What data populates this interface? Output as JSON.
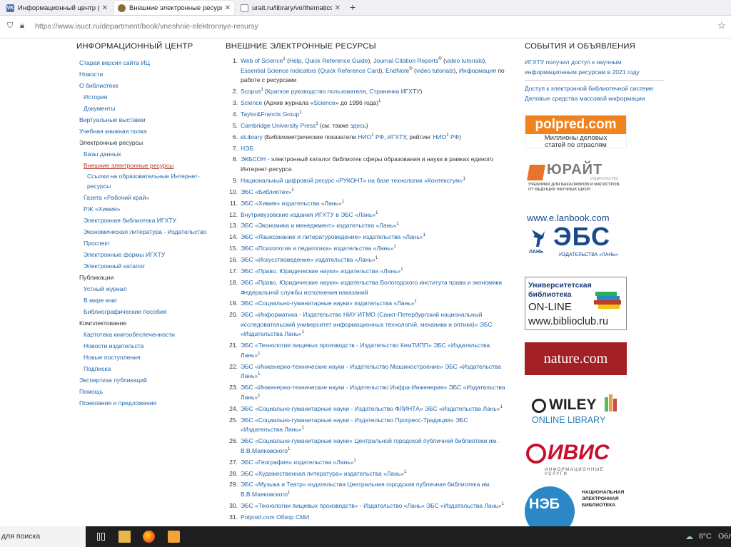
{
  "tabs": [
    {
      "title": "Информационный центр (биб",
      "icon": "vk-icon",
      "color": "#4a76a8"
    },
    {
      "title": "Внешние электронные ресурсы",
      "icon": "site-icon",
      "color": "#8a6a3a"
    },
    {
      "title": "urait.ru/library/vo/thematics/yu",
      "icon": "page-icon",
      "color": "#777"
    }
  ],
  "url": "https://www.isuct.ru/department/book/vneshnie-elektronnye-resursy",
  "headings": {
    "left": "ИНФОРМАЦИОННЫЙ ЦЕНТР",
    "mid": "ВНЕШНИЕ ЭЛЕКТРОННЫЕ РЕСУРСЫ",
    "right": "СОБЫТИЯ И ОБЪЯВЛЕНИЯ"
  },
  "left_nav": [
    {
      "label": "Старая версия сайта ИЦ",
      "level": 0
    },
    {
      "label": "Новости",
      "level": 0
    },
    {
      "label": "О библиотеке",
      "level": 0
    },
    {
      "label": "История",
      "level": 1
    },
    {
      "label": "Документы",
      "level": 1
    },
    {
      "label": "Виртуальные выставки",
      "level": 0
    },
    {
      "label": "Учебная книжная полка",
      "level": 0
    },
    {
      "label": "Электронные ресурсы",
      "level": 0,
      "group": true
    },
    {
      "label": "Базы данных",
      "level": 1
    },
    {
      "label": "Внешние электронные ресурсы",
      "level": 1,
      "current": true
    },
    {
      "label": "Ссылки на образовательные Интернет-ресурсы",
      "level": 2
    },
    {
      "label": "Газета «Рабочий край»",
      "level": 1
    },
    {
      "label": "РЖ «Химия»",
      "level": 1
    },
    {
      "label": "Электронная библиотека ИГХТУ",
      "level": 1
    },
    {
      "label": "Экономическая литература - Издательство Проспект",
      "level": 1,
      "wrap": true
    },
    {
      "label": "Электронные формы ИГХТУ",
      "level": 1
    },
    {
      "label": "Электронный каталог",
      "level": 1
    },
    {
      "label": "Публикации",
      "level": 0,
      "group": true
    },
    {
      "label": "Устный журнал",
      "level": 1
    },
    {
      "label": "В мире книг",
      "level": 1
    },
    {
      "label": "Библиографические пособия",
      "level": 1
    },
    {
      "label": "Комплектование",
      "level": 0,
      "group": true
    },
    {
      "label": "Картотека книгообеспеченности",
      "level": 1
    },
    {
      "label": "Новости издательств",
      "level": 1
    },
    {
      "label": "Новые поступления",
      "level": 1
    },
    {
      "label": "Подписка",
      "level": 1
    },
    {
      "label": "Экспертиза публикаций",
      "level": 0
    },
    {
      "label": "Помощь",
      "level": 0
    },
    {
      "label": "Пожелания и предложения",
      "level": 0
    }
  ],
  "resources": [
    {
      "n": "1.",
      "parts": [
        {
          "t": "Web of Science",
          "l": 1,
          "s": "1"
        },
        {
          "t": " ("
        },
        {
          "t": "Help",
          "l": 1
        },
        {
          "t": ", "
        },
        {
          "t": "Quick Reference Guide",
          "l": 1
        },
        {
          "t": "), "
        },
        {
          "t": "Journal Citation Reports",
          "l": 1,
          "s": "®"
        },
        {
          "t": " ("
        },
        {
          "t": "video tutorials",
          "l": 1
        },
        {
          "t": "), "
        },
        {
          "t": "Essential Science Indicators",
          "l": 1
        },
        {
          "t": " ("
        },
        {
          "t": "Quick Reference Card",
          "l": 1
        },
        {
          "t": "), "
        },
        {
          "t": "EndNote",
          "l": 1,
          "s": "®"
        },
        {
          "t": " ("
        },
        {
          "t": "video tutorials",
          "l": 1
        },
        {
          "t": "), "
        },
        {
          "t": "Информация",
          "l": 1
        },
        {
          "t": " по работе с ресурсами"
        }
      ]
    },
    {
      "n": "2.",
      "parts": [
        {
          "t": "Scopus",
          "l": 1,
          "s": "1"
        },
        {
          "t": " ("
        },
        {
          "t": "Краткое руководство пользователя",
          "l": 1
        },
        {
          "t": ", "
        },
        {
          "t": "Страничка ИГХТУ",
          "l": 1
        },
        {
          "t": ")"
        }
      ]
    },
    {
      "n": "3.",
      "parts": [
        {
          "t": "Science",
          "l": 1
        },
        {
          "t": " (Архив журнала «"
        },
        {
          "t": "Science",
          "l": 1
        },
        {
          "t": "» до 1996 года)",
          "s": "1"
        }
      ]
    },
    {
      "n": "4.",
      "parts": [
        {
          "t": "Taylor&Francis Group",
          "l": 1,
          "s": "1"
        }
      ]
    },
    {
      "n": "5.",
      "parts": [
        {
          "t": "Cambridge University Press",
          "l": 1,
          "s": "1"
        },
        {
          "t": " (см. также "
        },
        {
          "t": "здесь",
          "l": 1
        },
        {
          "t": ")"
        }
      ]
    },
    {
      "n": "6.",
      "parts": [
        {
          "t": "eLibrary",
          "l": 1
        },
        {
          "t": " (Библиометрические показатели "
        },
        {
          "t": "НИО",
          "l": 1,
          "s": "1"
        },
        {
          "t": " "
        },
        {
          "t": "РФ",
          "l": 1
        },
        {
          "t": ", "
        },
        {
          "t": "ИГХТУ",
          "l": 1
        },
        {
          "t": ", рейтинг "
        },
        {
          "t": "НИО",
          "l": 1,
          "s": "1"
        },
        {
          "t": " "
        },
        {
          "t": "РФ",
          "l": 1
        },
        {
          "t": ")"
        }
      ]
    },
    {
      "n": "7.",
      "parts": [
        {
          "t": "НЭБ",
          "l": 1
        }
      ]
    },
    {
      "n": "8.",
      "parts": [
        {
          "t": "ЭКБСОН",
          "l": 1
        },
        {
          "t": " - электронный каталог библиотек сферы образования и науки в рамках единого Интернет-ресурса"
        }
      ]
    },
    {
      "n": "9.",
      "parts": [
        {
          "t": "Национальный цифровой ресурс «РУКОНТ» на базе технологии «Контекстум»",
          "l": 1,
          "s": "1"
        }
      ]
    },
    {
      "n": "10.",
      "parts": [
        {
          "t": "ЭБС «Библиотех»",
          "l": 1,
          "s": "1"
        }
      ]
    },
    {
      "n": "11.",
      "parts": [
        {
          "t": "ЭБС «Химия» издательства «Лань»",
          "l": 1,
          "s": "1"
        }
      ]
    },
    {
      "n": "12.",
      "parts": [
        {
          "t": "Внутривузовские издания ИГХТУ в ЭБС «Лань»",
          "l": 1,
          "s": "1"
        }
      ]
    },
    {
      "n": "13.",
      "parts": [
        {
          "t": "ЭБС «Экономика и менеджмент» издательства «Лань»",
          "l": 1,
          "s": "1"
        }
      ]
    },
    {
      "n": "14.",
      "parts": [
        {
          "t": "ЭБС «Языкознание и литературоведение» издательства «Лань»",
          "l": 1,
          "s": "1"
        }
      ]
    },
    {
      "n": "15.",
      "parts": [
        {
          "t": "ЭБС «Психология и педагогика» издательства «Лань»",
          "l": 1,
          "s": "1"
        }
      ]
    },
    {
      "n": "16.",
      "parts": [
        {
          "t": "ЭБС «Искусствоведение» издательства «Лань»",
          "l": 1,
          "s": "1"
        }
      ]
    },
    {
      "n": "17.",
      "parts": [
        {
          "t": "ЭБС «Право. Юридические науки» издательства «Лань»",
          "l": 1,
          "s": "1"
        }
      ]
    },
    {
      "n": "18.",
      "parts": [
        {
          "t": "ЭБС «Право. Юридические науки» издательства Вологодского института права и экономики Федеральной службы исполнения наказаний",
          "l": 1
        }
      ]
    },
    {
      "n": "19.",
      "parts": [
        {
          "t": "ЭБС «Социально-гуманитарные науки» издательства «Лань»",
          "l": 1,
          "s": "1"
        }
      ]
    },
    {
      "n": "20.",
      "parts": [
        {
          "t": "ЭБС «Информатика - Издательство НИУ ИТМО (Санкт-Петербургский национальный исследовательский университет информационных технологий, механики и оптики)» ЭБС «Издательства Лань»",
          "l": 1,
          "s": "1"
        }
      ]
    },
    {
      "n": "21.",
      "parts": [
        {
          "t": "ЭБС «Технологии пищевых производств - Издательство КемТИПП» ЭБС «Издательства Лань»",
          "l": 1,
          "s": "1"
        }
      ]
    },
    {
      "n": "22.",
      "parts": [
        {
          "t": "ЭБС «Инженерно-технические науки - Издательство Машиностроение» ЭБС «Издательства Лань»",
          "l": 1,
          "s": "1"
        }
      ]
    },
    {
      "n": "23.",
      "parts": [
        {
          "t": "ЭБС «Инженерно-технические науки - Издательство Инфра-Инженерия» ЭБС «Издательства Лань»",
          "l": 1,
          "s": "1"
        }
      ]
    },
    {
      "n": "24.",
      "parts": [
        {
          "t": "ЭБС «Социально-гуманитарные науки - Издательство ФЛИНТА» ЭБС «Издательства Лань»",
          "l": 1,
          "s": "1"
        }
      ]
    },
    {
      "n": "25.",
      "parts": [
        {
          "t": "ЭБС «Социально-гуманитарные науки - Издательство Прогресс-Традиция» ЭБС «Издательства Лань»",
          "l": 1,
          "s": "1"
        }
      ]
    },
    {
      "n": "26.",
      "parts": [
        {
          "t": "ЭБС «Социально-гуманитарные науки» Центральной городской публичной библиотеки им. В.В.Маяковского",
          "l": 1,
          "s": "1"
        }
      ]
    },
    {
      "n": "27.",
      "parts": [
        {
          "t": "ЭБС «География» издательства «Лань»",
          "l": 1,
          "s": "1"
        }
      ]
    },
    {
      "n": "28.",
      "parts": [
        {
          "t": "ЭБС «Художественная литература» издательства «Лань»",
          "l": 1,
          "s": "1"
        }
      ]
    },
    {
      "n": "29.",
      "parts": [
        {
          "t": "ЭБС «Музыка и Театр» издательства Центральная городская публичная библиотека им. В.В.Маяковского",
          "l": 1,
          "s": "1"
        }
      ]
    },
    {
      "n": "30.",
      "parts": [
        {
          "t": "ЭБС «Технологии пищевых производств» - Издательство «Лань» ЭБС «Издательства Лань»",
          "l": 1,
          "s": "1"
        }
      ]
    },
    {
      "n": "31.",
      "parts": [
        {
          "t": "Polpred.com Обзор СМИ",
          "l": 1
        }
      ]
    }
  ],
  "events": [
    {
      "text": "ИГХТУ получил доступ к научным информационным ресурсам в 2021 году"
    },
    {
      "text": "Доступ к электронной библиотечной системе",
      "sep": true
    },
    {
      "text": "Деловые средства массовой информации"
    }
  ],
  "banners": {
    "polpred": {
      "title": "polpred.com",
      "sub": "Миллионы деловых статей по отраслям"
    },
    "urait": {
      "title": "ЮРАЙТ",
      "small": "ИЗДАТЕЛЬСТВО",
      "sub": "УЧЕБНИКИ ДЛЯ БАКАЛАВРОВ И МАГИСТРОВ ОТ ВЕДУЩИХ НАУЧНЫХ ШКОЛ"
    },
    "lanbook": {
      "url": "www.e.lanbook.com",
      "ebs": "ЭБС",
      "lan": "ЛАНЬ",
      "sub": "ИЗДАТЕЛЬСТВА «ЛАНЬ»"
    },
    "biblioclub": {
      "l1": "Университетская",
      "l2": "библиотека",
      "l3": "ON-LINE",
      "url": "www.biblioclub.ru"
    },
    "nature": {
      "text": "nature.com"
    },
    "wiley": {
      "t1": "WILEY",
      "t2": "ONLINE LIBRARY"
    },
    "ivis": {
      "t1": "ИВИС",
      "t2": "ИНФОРМАЦИОННЫЕ УСЛУГИ"
    },
    "neb": {
      "t1": "НЭБ",
      "l1": "НАЦИОНАЛЬНАЯ",
      "l2": "ЭЛЕКТРОННАЯ",
      "l3": "БИБЛИОТЕКА"
    }
  },
  "taskbar": {
    "search": "для поиска",
    "weather": "8°C",
    "extra": "Обла"
  },
  "colors": {
    "link": "#2366a8",
    "current": "#b23b2b",
    "polpred_orange": "#f0831e",
    "nature_red": "#a32024",
    "urait_orange": "#e8732a",
    "ivis_red": "#c8102e",
    "lan_blue": "#1a4a8a"
  }
}
